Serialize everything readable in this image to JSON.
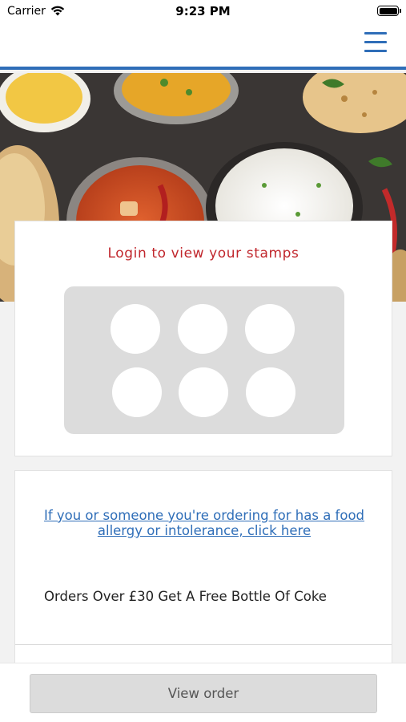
{
  "status_bar": {
    "carrier": "Carrier",
    "time": "9:23 PM",
    "icons": [
      "wifi-icon",
      "battery-icon"
    ]
  },
  "nav": {
    "menu_icon": "hamburger-menu-icon",
    "accent_color": "#2f6eb8"
  },
  "hero": {
    "image": "food-banner"
  },
  "stamps": {
    "title": "Login to view your stamps",
    "title_color": "#c1272d",
    "stamp_count": 6
  },
  "info": {
    "allergy_link": "If you or someone you're ordering for has a food allergy or intolerance, click here",
    "promo": "Orders Over £30 Get A Free Bottle Of Coke"
  },
  "footer": {
    "view_order_label": "View order"
  }
}
